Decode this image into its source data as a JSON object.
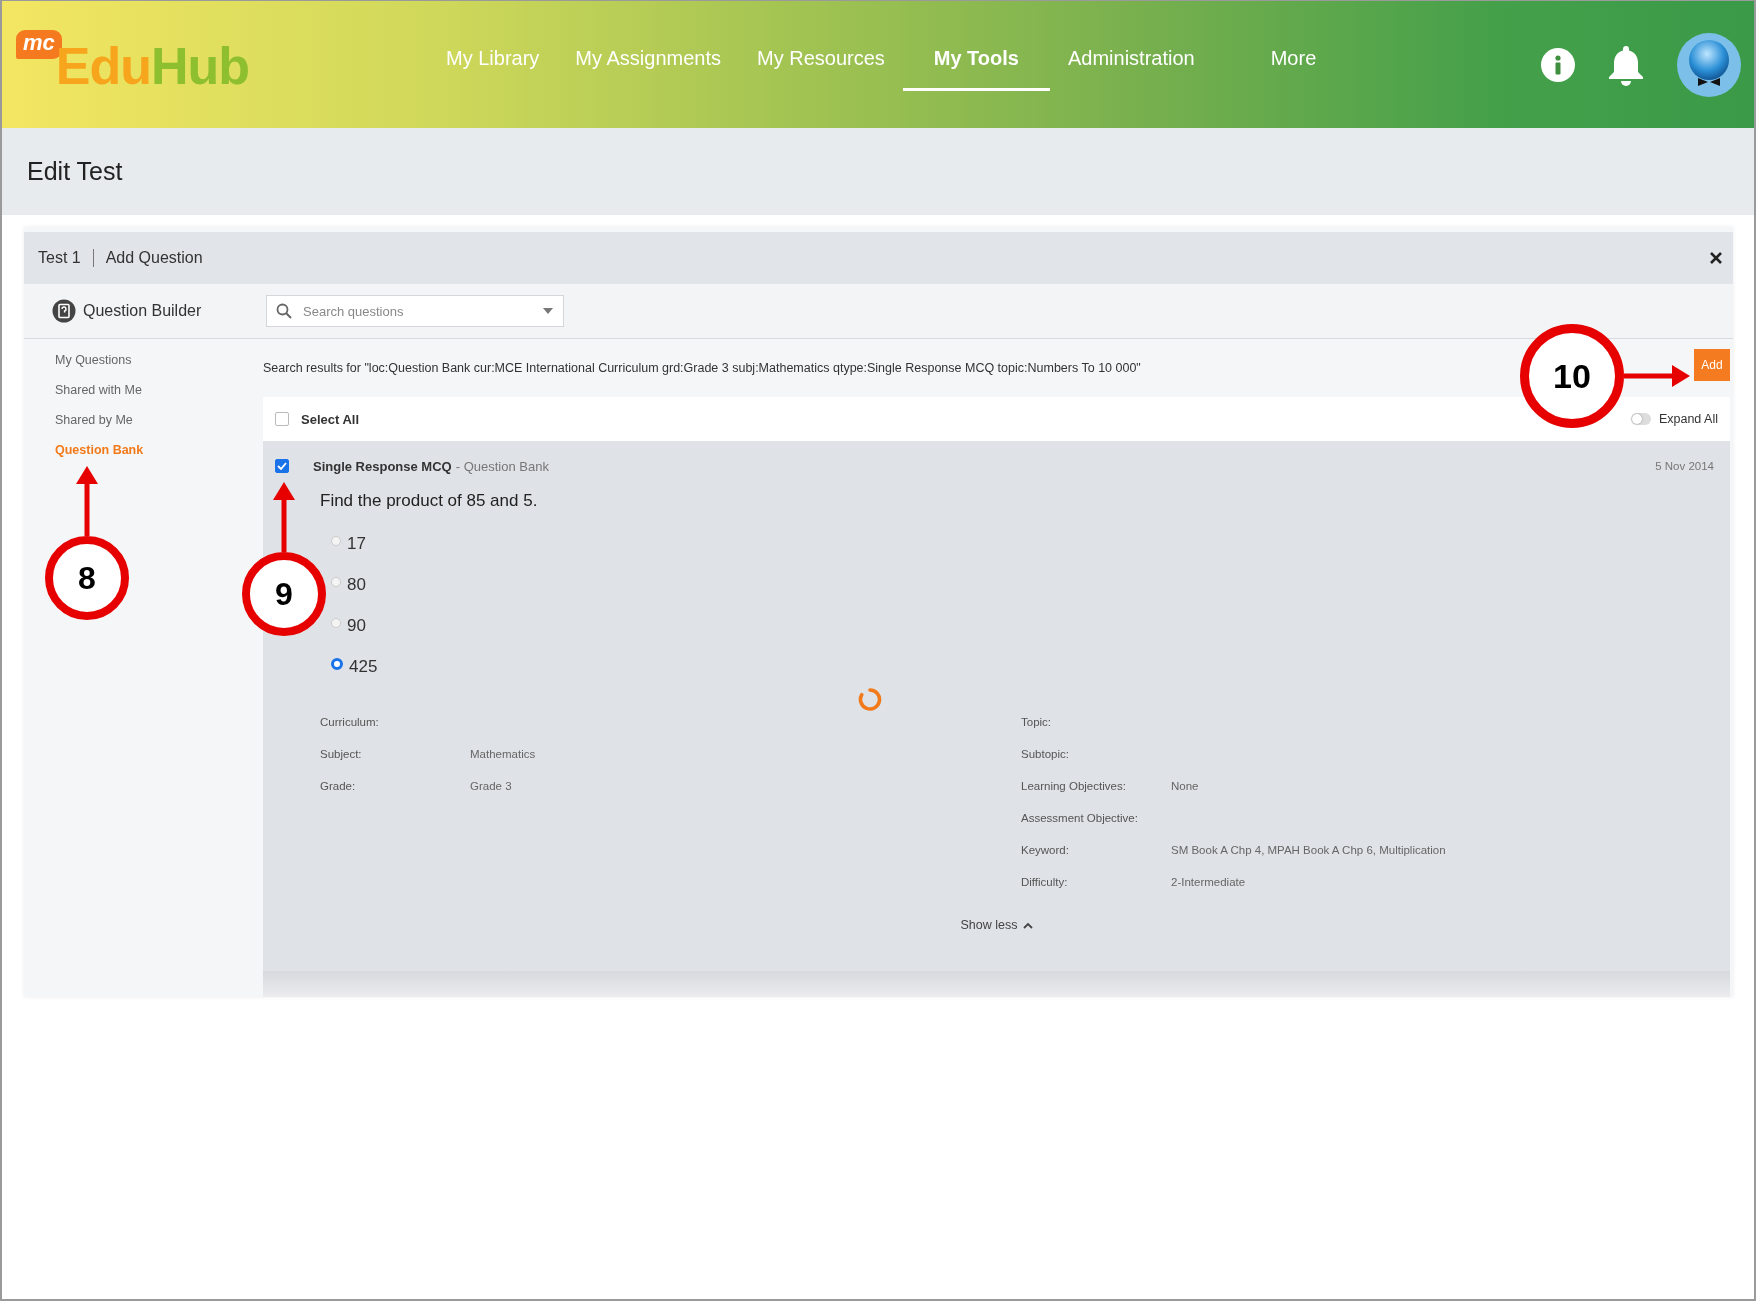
{
  "header": {
    "logo": {
      "badge": "mc",
      "name_a": "Edu",
      "name_b": "Hub"
    },
    "nav": [
      {
        "label": "My Library",
        "selected": false
      },
      {
        "label": "My Assignments",
        "selected": false
      },
      {
        "label": "My Resources",
        "selected": false
      },
      {
        "label": "My Tools",
        "selected": true
      },
      {
        "label": "Administration",
        "selected": false
      },
      {
        "label": "More",
        "selected": false
      }
    ]
  },
  "page_title": "Edit Test",
  "panel": {
    "breadcrumb": [
      "Test 1",
      "Add Question"
    ],
    "builder_title": "Question Builder",
    "search": {
      "placeholder": "Search questions"
    },
    "sidebar": [
      {
        "label": "My Questions",
        "selected": false
      },
      {
        "label": "Shared with Me",
        "selected": false
      },
      {
        "label": "Shared by Me",
        "selected": false
      },
      {
        "label": "Question Bank",
        "selected": true,
        "callout": {
          "label": "8",
          "kind": "up"
        }
      }
    ],
    "results_text": "Search results for \"loc:Question Bank cur:MCE International Curriculum grd:Grade 3 subj:Mathematics qtype:Single Response MCQ topic:Numbers To 10 000\"",
    "add_button": {
      "label": "Add",
      "callout": {
        "label": "10",
        "kind": "right"
      }
    },
    "select_all": {
      "label": "Select All",
      "checked": false
    },
    "expand_all": {
      "label": "Expand All",
      "on": false
    },
    "question": {
      "checked": true,
      "callout": {
        "label": "9",
        "kind": "up"
      },
      "type": "Single Response MCQ",
      "source": "- Question Bank",
      "date": "5 Nov 2014",
      "text": "Find the product of 85 and 5.",
      "options": [
        {
          "label": "17",
          "selected": false
        },
        {
          "label": "80",
          "selected": false
        },
        {
          "label": "90",
          "selected": false
        },
        {
          "label": "425",
          "selected": true
        }
      ],
      "meta_left": [
        {
          "label": "Curriculum:"
        },
        {
          "label": "Subject:",
          "value": "Mathematics"
        },
        {
          "label": "Grade:",
          "value": "Grade 3"
        }
      ],
      "meta_right": [
        {
          "label": "Topic:"
        },
        {
          "label": "Subtopic:"
        },
        {
          "label": "Learning Objectives:",
          "value": "None"
        },
        {
          "label": "Assessment Objective:"
        },
        {
          "label": "Keyword:",
          "value": "SM Book A Chp 4, MPAH Book A Chp 6, Multiplication"
        },
        {
          "label": "Difficulty:",
          "value": "2-Intermediate"
        }
      ],
      "toggle_label": "Show less"
    }
  }
}
